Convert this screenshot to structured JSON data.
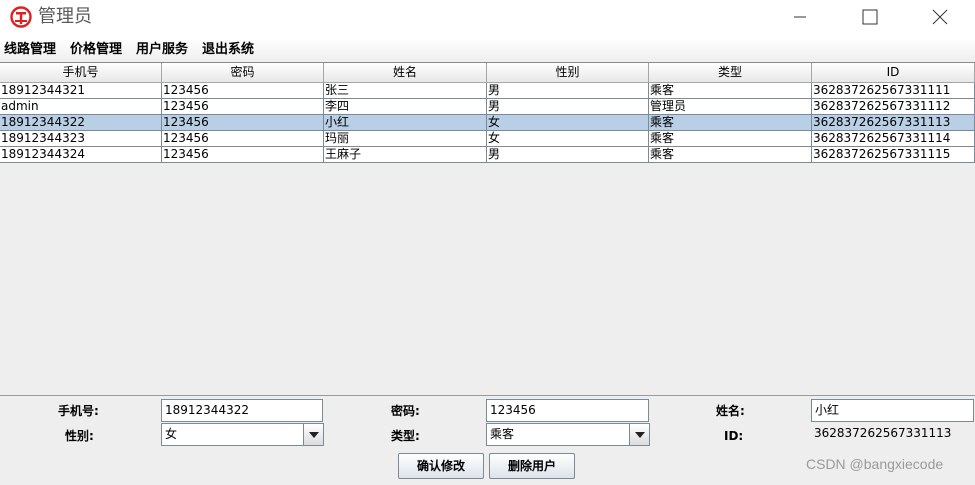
{
  "window": {
    "title": "管理员",
    "logo_icon": "railway-logo-icon",
    "accent": "#e02020"
  },
  "menu": [
    "线路管理",
    "价格管理",
    "用户服务",
    "退出系统"
  ],
  "table": {
    "columns": [
      "手机号",
      "密码",
      "姓名",
      "性别",
      "类型",
      "ID"
    ],
    "rows": [
      [
        "18912344321",
        "123456",
        "张三",
        "男",
        "乘客",
        "362837262567331111"
      ],
      [
        "admin",
        "123456",
        "李四",
        "男",
        "管理员",
        "362837262567331112"
      ],
      [
        "18912344322",
        "123456",
        "小红",
        "女",
        "乘客",
        "362837262567331113"
      ],
      [
        "18912344323",
        "123456",
        "玛丽",
        "女",
        "乘客",
        "362837262567331114"
      ],
      [
        "18912344324",
        "123456",
        "王麻子",
        "男",
        "乘客",
        "362837262567331115"
      ]
    ],
    "selected_row": 2,
    "selected_color": "#b8cfe5"
  },
  "form": {
    "phone_label": "手机号:",
    "phone_value": "18912344322",
    "password_label": "密码:",
    "password_value": "123456",
    "name_label": "姓名:",
    "name_value": "小红",
    "gender_label": "性别:",
    "gender_value": "女",
    "type_label": "类型:",
    "type_value": "乘客",
    "id_label": "ID:",
    "id_value": "362837262567331113",
    "confirm_button": "确认修改",
    "delete_button": "删除用户"
  },
  "watermark": "CSDN @bangxiecode"
}
